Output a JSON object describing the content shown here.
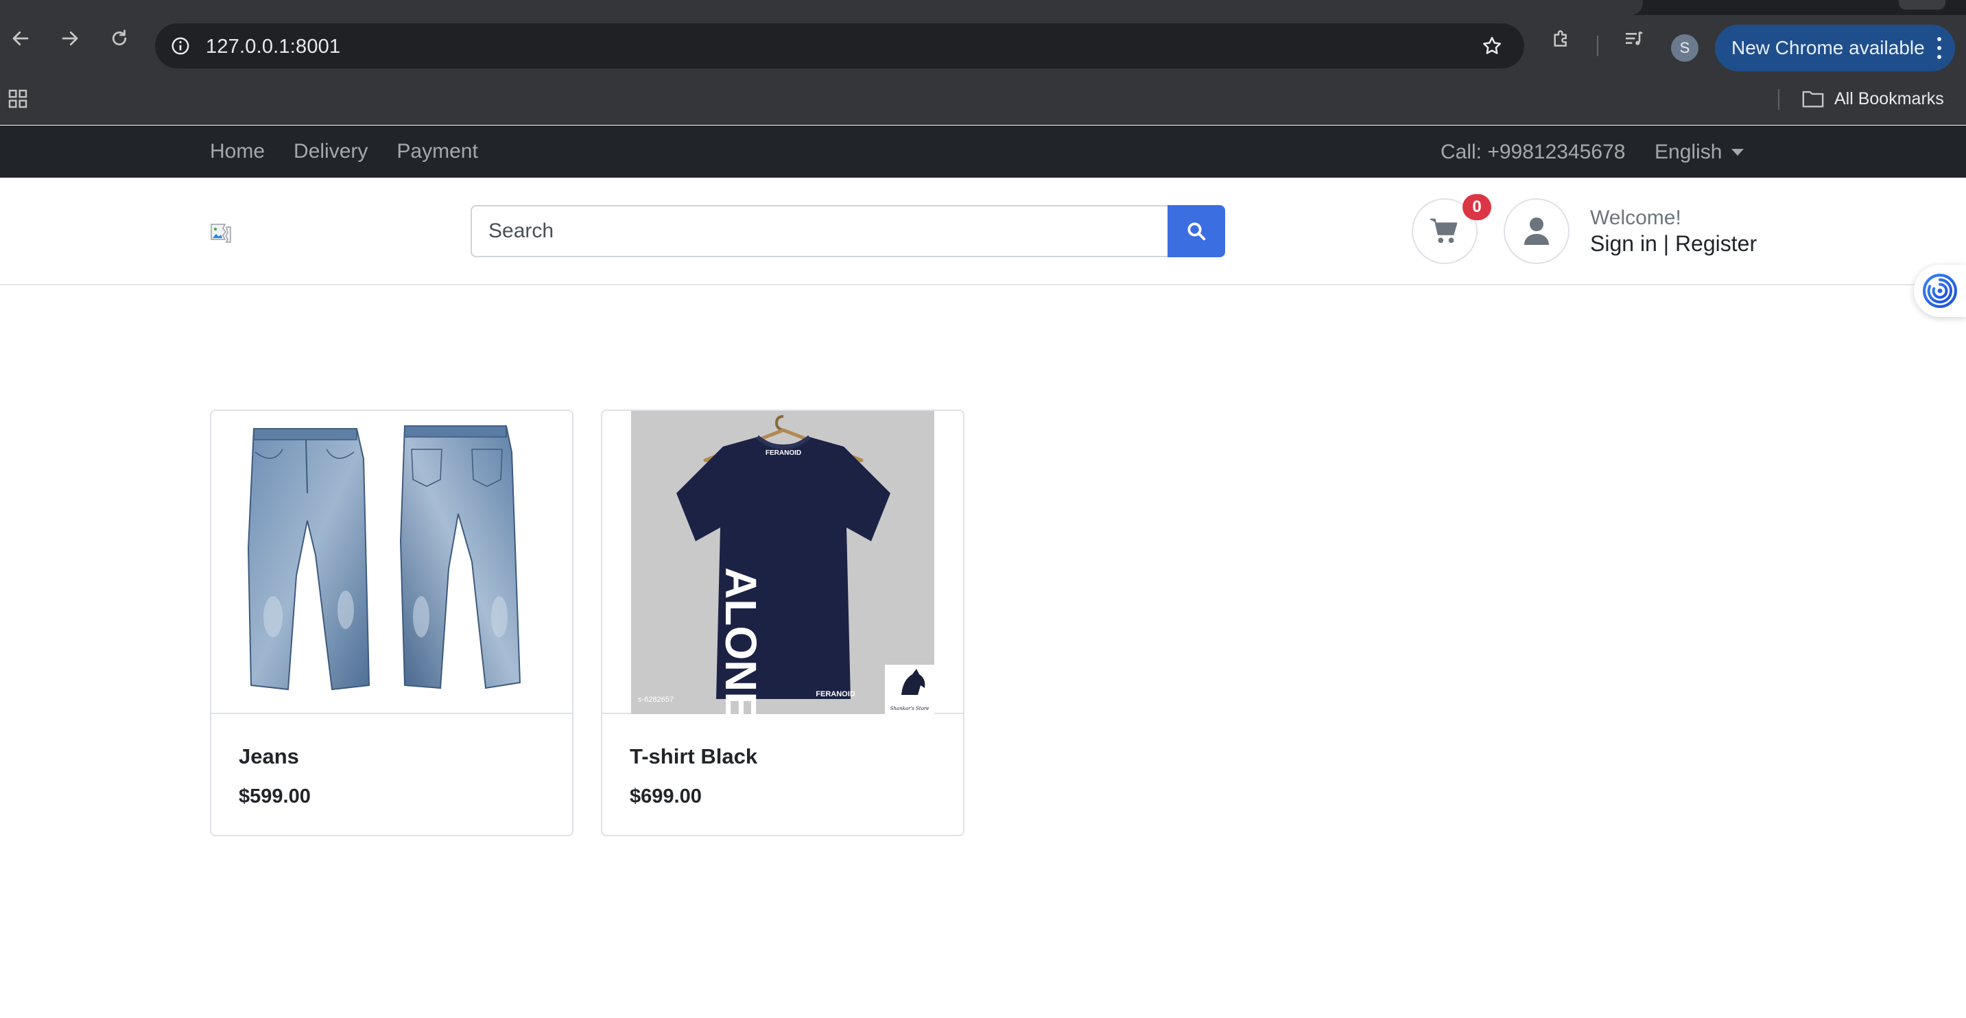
{
  "browser": {
    "url": "127.0.0.1:8001",
    "new_chrome_label": "New Chrome available",
    "profile_initial": "S",
    "all_bookmarks_label": "All Bookmarks",
    "icons": [
      "back-arrow-icon",
      "forward-arrow-icon",
      "reload-icon",
      "site-info-icon",
      "bookmark-star-icon",
      "extensions-icon",
      "media-controls-icon",
      "apps-grid-icon",
      "folder-icon",
      "kebab-menu-icon"
    ]
  },
  "topnav": {
    "links": [
      {
        "label": "Home"
      },
      {
        "label": "Delivery"
      },
      {
        "label": "Payment"
      }
    ],
    "phone": "Call: +99812345678",
    "language": "English"
  },
  "header": {
    "search_placeholder": "Search",
    "cart_count": "0",
    "welcome": "Welcome!",
    "sign_in": "Sign in",
    "separator": "|",
    "register": "Register"
  },
  "products": [
    {
      "name": "Jeans",
      "price": "$599.00",
      "image": "jeans-photo"
    },
    {
      "name": "T-shirt Black",
      "price": "$699.00",
      "image": "tshirt-photo"
    }
  ],
  "tshirt_print": {
    "brand": "FERANOID",
    "text": "ALONE",
    "code": "s-6282657",
    "logo_caption": "Shankar's Store"
  },
  "colors": {
    "topnav_bg": "#212529",
    "search_button": "#3b6ee0",
    "badge": "#dc3545",
    "new_chrome_pill": "#1f4e8c"
  }
}
